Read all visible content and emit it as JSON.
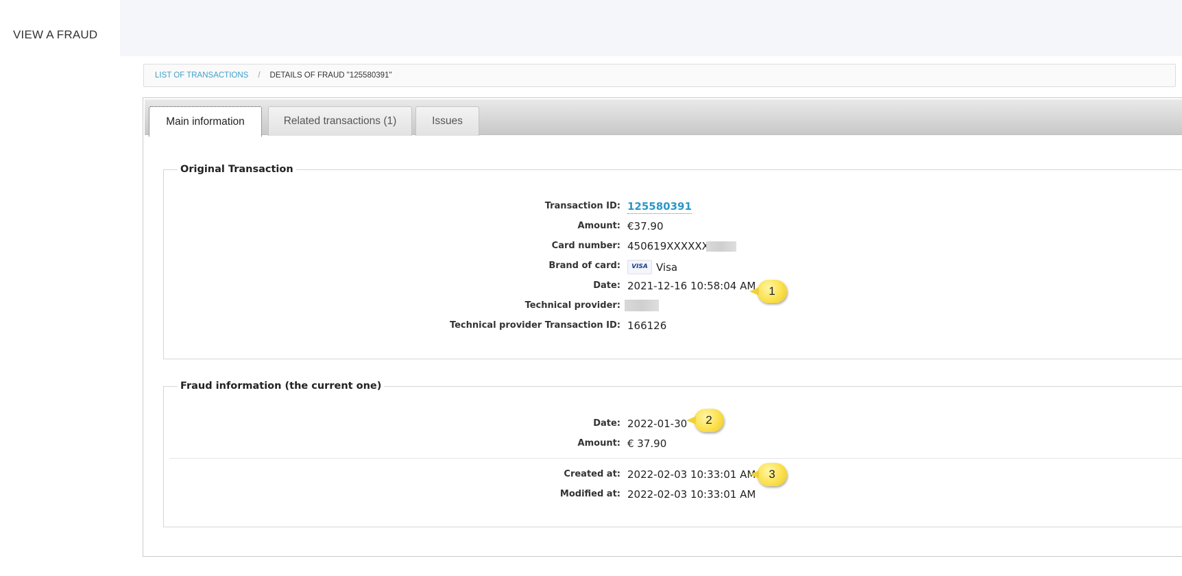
{
  "page": {
    "title": "VIEW A FRAUD"
  },
  "breadcrumb": {
    "link_label": "LIST OF TRANSACTIONS",
    "separator": "/",
    "current": "DETAILS OF FRAUD \"125580391\""
  },
  "tabs": [
    {
      "label": "Main information",
      "active": true
    },
    {
      "label": "Related transactions (1)",
      "active": false
    },
    {
      "label": "Issues",
      "active": false
    }
  ],
  "original_transaction": {
    "legend": "Original Transaction",
    "transaction_id": {
      "label": "Transaction ID:",
      "value": "125580391"
    },
    "amount": {
      "label": "Amount:",
      "value": "€37.90"
    },
    "card_number": {
      "label": "Card number:",
      "value": "450619XXXXXX"
    },
    "brand": {
      "label": "Brand of card:",
      "badge": "VISA",
      "value": "Visa"
    },
    "date": {
      "label": "Date:",
      "value": "2021-12-16 10:58:04 AM"
    },
    "technical_provider": {
      "label": "Technical provider:"
    },
    "technical_provider_txn": {
      "label": "Technical provider Transaction ID:",
      "value": "166126"
    }
  },
  "fraud_information": {
    "legend": "Fraud information (the current one)",
    "date": {
      "label": "Date:",
      "value": "2022-01-30"
    },
    "amount": {
      "label": "Amount:",
      "value": "€ 37.90"
    },
    "created_at": {
      "label": "Created at:",
      "value": "2022-02-03 10:33:01 AM"
    },
    "modified_at": {
      "label": "Modified at:",
      "value": "2022-02-03 10:33:01 AM"
    }
  },
  "callouts": [
    "1",
    "2",
    "3"
  ],
  "colors": {
    "link": "#2b97c7",
    "callout": "#fbe04c",
    "topbar": "#f5f6f9"
  }
}
